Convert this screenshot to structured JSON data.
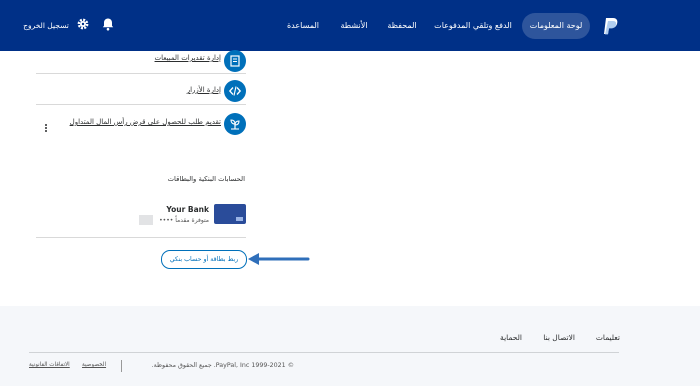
{
  "header": {
    "nav": [
      {
        "label": "لوحة المعلومات",
        "active": true
      },
      {
        "label": "الدفع وتلقي المدفوعات",
        "active": false
      },
      {
        "label": "المحفظة",
        "active": false
      },
      {
        "label": "الأنشطة",
        "active": false
      },
      {
        "label": "المساعدة",
        "active": false
      }
    ],
    "logout_label": "تسجيل الخروج",
    "icons": [
      "paypal-logo",
      "bell-icon",
      "gear-icon"
    ],
    "colors": {
      "bar": "#003087",
      "accent": "#0070ba"
    }
  },
  "tools": {
    "items": [
      {
        "label": "إدارة تقديرات المبيعات",
        "icon": "document-icon"
      },
      {
        "label": "إدارة الأزرار",
        "icon": "code-icon"
      },
      {
        "label": "تقديم طلب للحصول على قرض رأس المال المتداول",
        "icon": "plant-icon"
      }
    ]
  },
  "bank_section": {
    "title": "الحسابات البنكية والبطاقات",
    "bank_name": "Your Bank",
    "bank_status": "متوفرة مقدماً ••••",
    "link_button": "ربط بطاقة أو حساب بنكي"
  },
  "footer": {
    "links": [
      "تعليمات",
      "الاتصال بنا",
      "الحماية"
    ],
    "copyright": "© 1999-2021 PayPal, Inc. جميع الحقوق محفوظة.",
    "small_links": [
      "الخصوصية",
      "الاتفاقات القانونية"
    ]
  }
}
